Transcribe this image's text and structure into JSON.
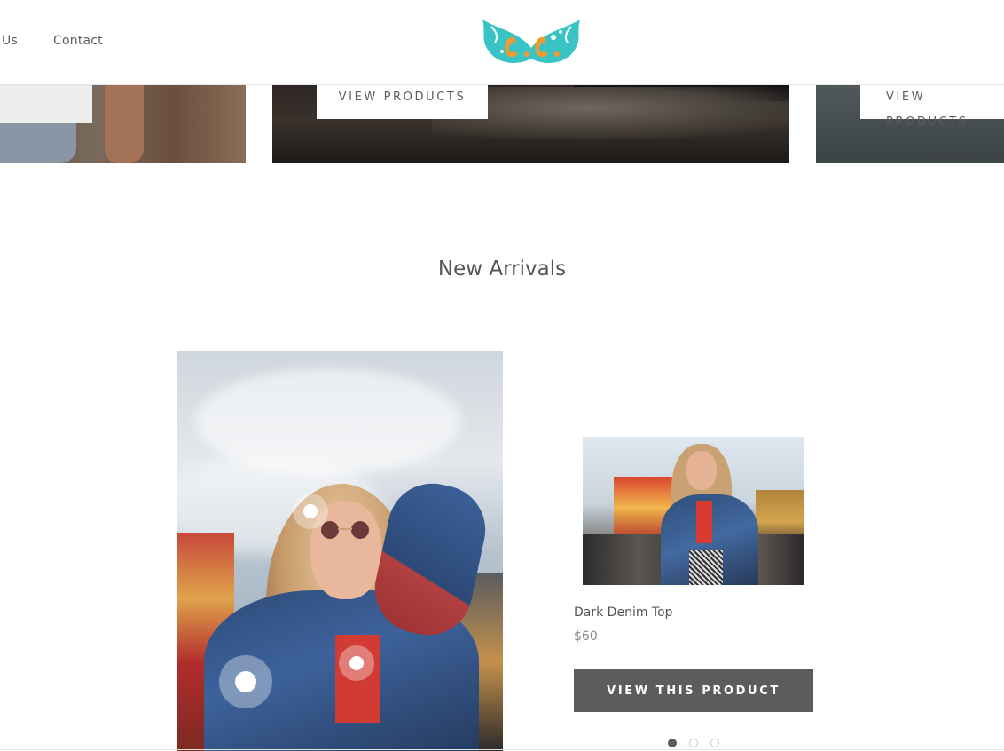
{
  "nav": {
    "about_fragment": "Us",
    "contact": "Contact"
  },
  "logo": {
    "text": "C.C",
    "colors": {
      "wings": "#38c3c5",
      "letters": "#f29a2e"
    }
  },
  "collections": {
    "button_label": "VIEW PRODUCTS"
  },
  "section": {
    "title": "New Arrivals"
  },
  "product": {
    "name": "Dark Denim Top",
    "price": "$60",
    "button_label": "VIEW THIS PRODUCT"
  },
  "slider": {
    "dot_count": 3,
    "active_index": 0
  },
  "colors": {
    "text": "#5c5c5c",
    "button_dark": "#5c5c5c",
    "background": "#ffffff"
  }
}
